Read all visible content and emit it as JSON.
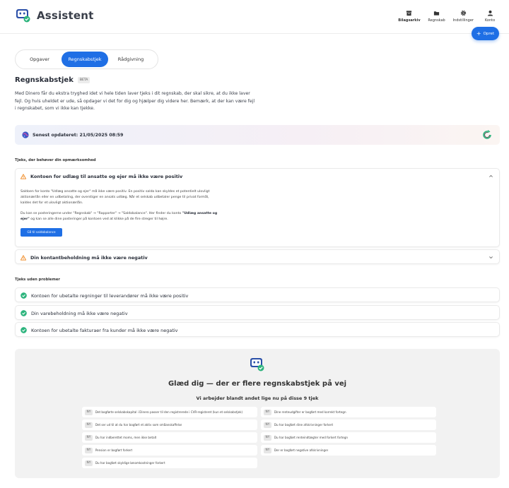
{
  "header": {
    "title": "Assistent",
    "nav": [
      {
        "label": "Bilagsarkiv",
        "icon": "archive-icon",
        "active": true
      },
      {
        "label": "Regnskab",
        "icon": "folder-icon",
        "active": false
      },
      {
        "label": "Indstillinger",
        "icon": "gear-icon",
        "active": false
      },
      {
        "label": "Konto",
        "icon": "user-icon",
        "active": false
      }
    ],
    "create_label": "Opret"
  },
  "tabs": [
    {
      "label": "Opgaver",
      "active": false
    },
    {
      "label": "Regnskabstjek",
      "active": true
    },
    {
      "label": "Rådgivning",
      "active": false
    }
  ],
  "page": {
    "title": "Regnskabstjek",
    "badge": "BETA",
    "intro": "Med Dinero får du ekstra tryghed idet vi hele tiden laver tjeks i dit regnskab, der skal sikre, at du ikke laver fejl. Og hvis uheldet er ude, så opdager vi det for dig og hjælper dig videre her. Bemærk, at der kan være fejl i regnskabet, som vi ikke kan tjekke."
  },
  "updated": {
    "text": "Senest opdateret: 21/05/2025 08:59"
  },
  "attention": {
    "label": "Tjeks, der behøver din opmærksomhed",
    "items": [
      {
        "title": "Kontoen for udlæg til ansatte og ejer må ikke være positiv",
        "expanded": true,
        "p1": "Saldoen for konto \"Udlæg ansatte og ejer\" må ikke være positiv. En positiv saldo kan skyldes et potentielt ulovligt aktionærlån eller en udbetaling, der overstiger en ansats udlæg. Når et selskab udbetaler penge til privat formål, kaldes det for et ulovligt aktionærlån.",
        "p2_pre": "Du kan se posteringerne under \"Regnskab\" → \"Rapporter\" → \"Saldobalance\". Her finder du konto ",
        "p2_bold": "\"Udlæg ansatte og ejer\"",
        "p2_post": " og kan se alle dine posteringer på kontoen ved at klikke på de fire streger til højre.",
        "button": "Gå til saldobalance"
      },
      {
        "title": "Din kontantbeholdning må ikke være negativ",
        "expanded": false
      }
    ]
  },
  "ok": {
    "label": "Tjeks uden problemer",
    "items": [
      {
        "title": "Kontoen for ubetalte regninger til leverandører må ikke være positiv"
      },
      {
        "title": "Din varebeholdning må ikke være negativ"
      },
      {
        "title": "Kontoen for ubetalte fakturaer fra kunder må ikke være negativ"
      }
    ]
  },
  "promo": {
    "title": "Glæd dig — der er flere regnskabstjek på vej",
    "subtitle": "Vi arbejder blandt andet lige nu på disse 9 tjek",
    "badge": "NY",
    "items": [
      "Det bogførte selskabskapital i Dinero passer til den registrerede i CVR-registeret (kun et selskabstjek)",
      "Dine renteudgifter er bogført med korrekt fortegn",
      "Det ser ud til at du har bogført et aktiv som småanskaffelse",
      "Du har bogført dine afskrivninger forkert",
      "Du har indberettet moms, men ikke betalt",
      "Du har bogført renteindtægter med forkert fortegn",
      "Pension er bogført forkert",
      "Der er bogført negative afskrivninger",
      "Du har bogført skyldige lønomkostninger forkert"
    ]
  },
  "colors": {
    "accent": "#1f6fe5",
    "warning": "#f08a24",
    "success": "#2db47d"
  }
}
